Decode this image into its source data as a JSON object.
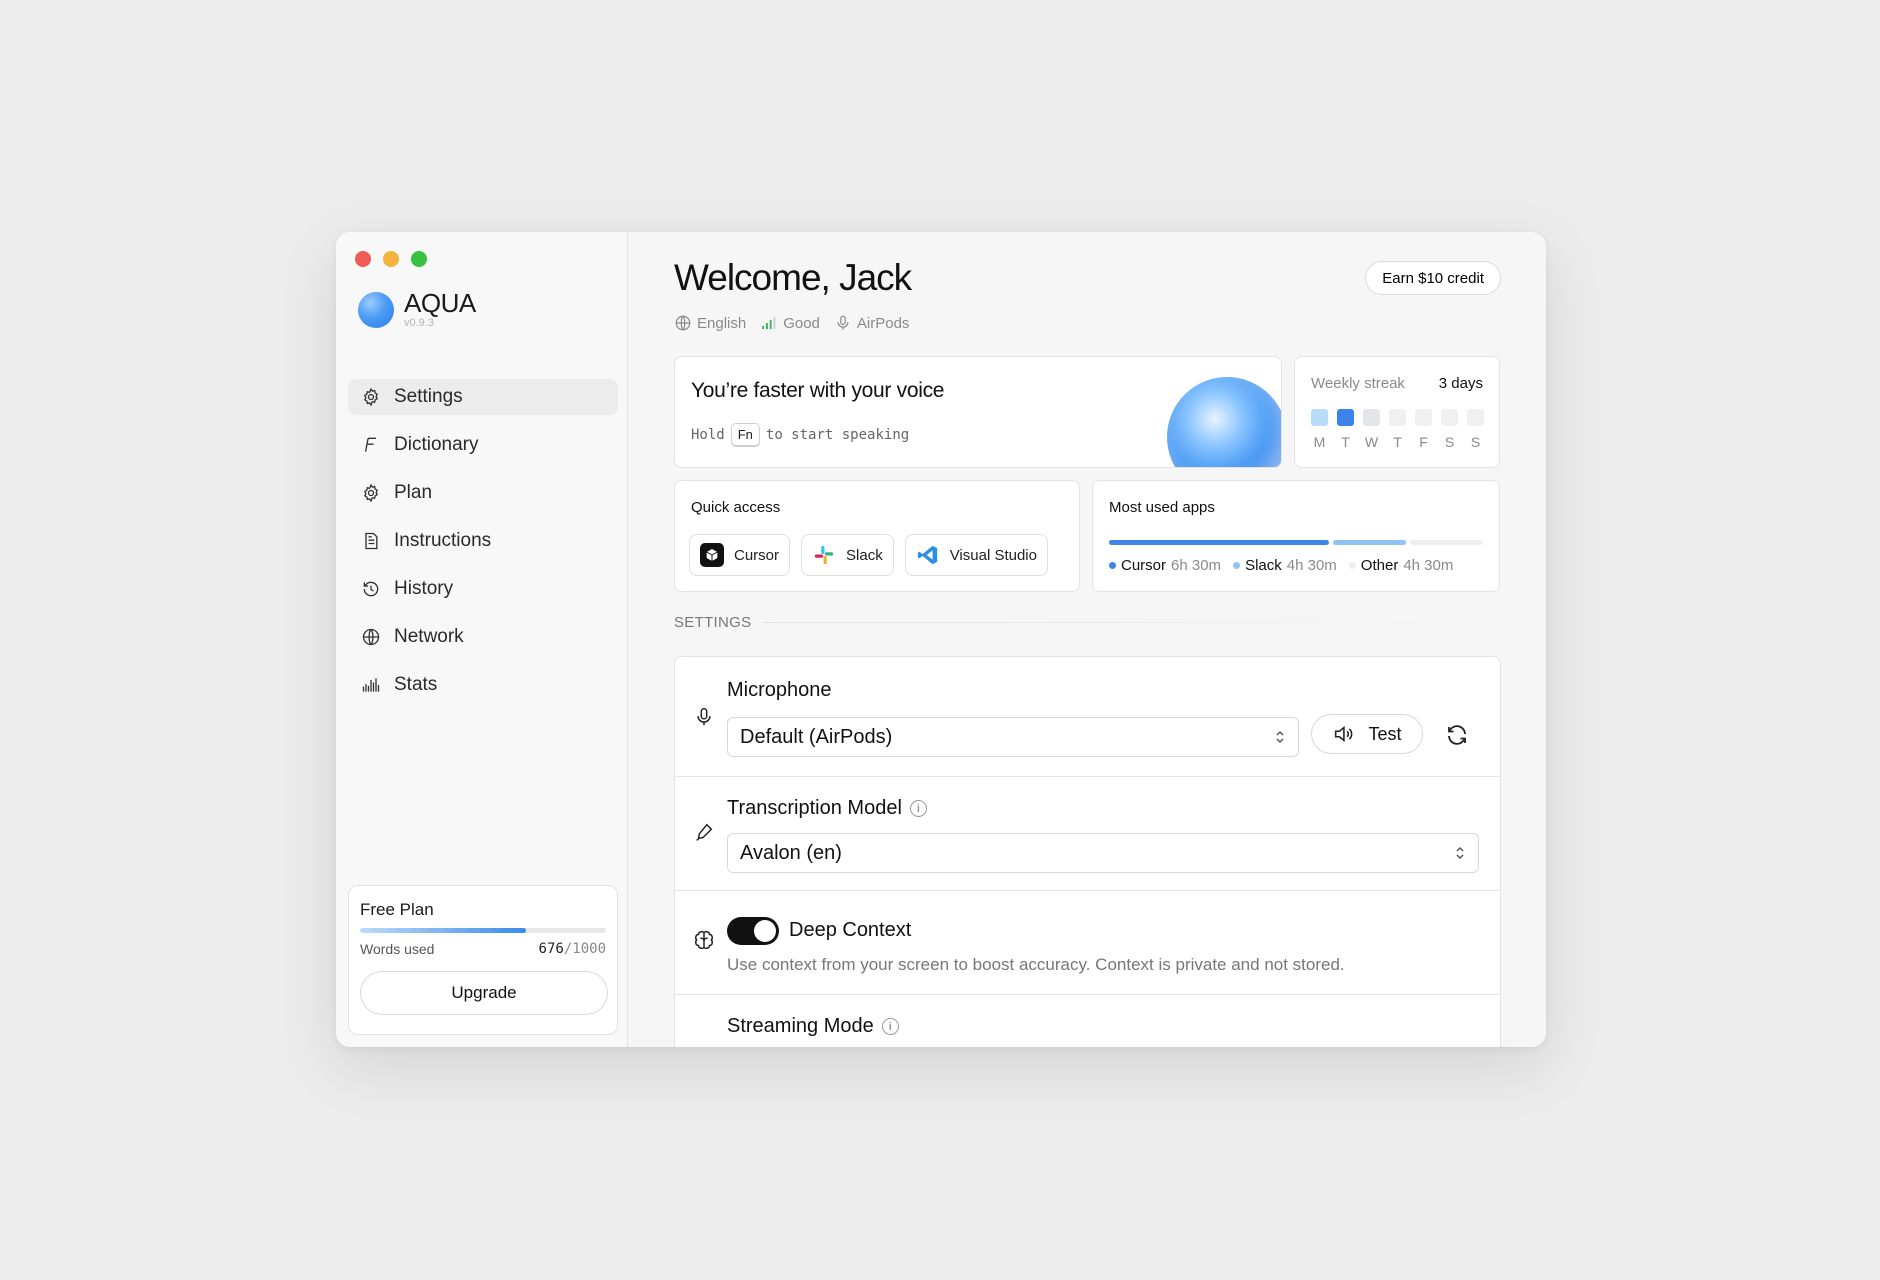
{
  "app": {
    "name": "AQUA",
    "version": "v0.9.3"
  },
  "sidebar": {
    "items": [
      {
        "label": "Settings",
        "icon": "gear-icon",
        "active": true
      },
      {
        "label": "Dictionary",
        "icon": "script-f-icon",
        "active": false
      },
      {
        "label": "Plan",
        "icon": "gear-icon",
        "active": false
      },
      {
        "label": "Instructions",
        "icon": "document-icon",
        "active": false
      },
      {
        "label": "History",
        "icon": "history-icon",
        "active": false
      },
      {
        "label": "Network",
        "icon": "globe-icon",
        "active": false
      },
      {
        "label": "Stats",
        "icon": "bars-icon",
        "active": false
      }
    ],
    "plan": {
      "title": "Free Plan",
      "words_label": "Words used",
      "words_used": "676",
      "words_sep": "/",
      "words_limit": "1000",
      "usage_fraction": 0.676,
      "upgrade_label": "Upgrade"
    }
  },
  "header": {
    "title": "Welcome, Jack",
    "earn_label": "Earn $10 credit",
    "status": {
      "language": "English",
      "connection": "Good",
      "device": "AirPods"
    }
  },
  "hero": {
    "title": "You’re faster with your voice",
    "hint_prefix": "Hold",
    "hint_key": "Fn",
    "hint_suffix": "to start speaking"
  },
  "streak": {
    "label": "Weekly streak",
    "value": "3 days",
    "days": [
      "M",
      "T",
      "W",
      "T",
      "F",
      "S",
      "S"
    ],
    "colors": [
      "#b9dcfb",
      "#3c84ea",
      "#e4e6ea",
      "#f0f0f0",
      "#f0f0f0",
      "#f0f0f0",
      "#f0f0f0"
    ]
  },
  "quick_access": {
    "label": "Quick access",
    "apps": [
      {
        "name": "Cursor",
        "icon": "cursor-app-icon"
      },
      {
        "name": "Slack",
        "icon": "slack-app-icon"
      },
      {
        "name": "Visual Studio",
        "icon": "vscode-app-icon"
      }
    ]
  },
  "most_used": {
    "label": "Most used apps",
    "apps": [
      {
        "name": "Cursor",
        "time": "6h 30m",
        "share": 0.6,
        "color": "#3c84ea"
      },
      {
        "name": "Slack",
        "time": "4h 30m",
        "share": 0.2,
        "color": "#8ec3f5"
      },
      {
        "name": "Other",
        "time": "4h 30m",
        "share": 0.2,
        "color": "#eeeeee"
      }
    ]
  },
  "settings": {
    "section_label": "SETTINGS",
    "microphone": {
      "title": "Microphone",
      "value": "Default (AirPods)",
      "test_label": "Test"
    },
    "transcription": {
      "title": "Transcription Model",
      "value": "Avalon (en)"
    },
    "deep_context": {
      "title": "Deep Context",
      "enabled": true,
      "description": "Use context from your screen to boost accuracy. Context is private and not stored."
    },
    "streaming": {
      "title": "Streaming Mode"
    }
  },
  "colors": {
    "accent": "#3c84ea",
    "traffic_red": "#ee5c55",
    "traffic_yellow": "#f3b33c",
    "traffic_green": "#37c141"
  }
}
